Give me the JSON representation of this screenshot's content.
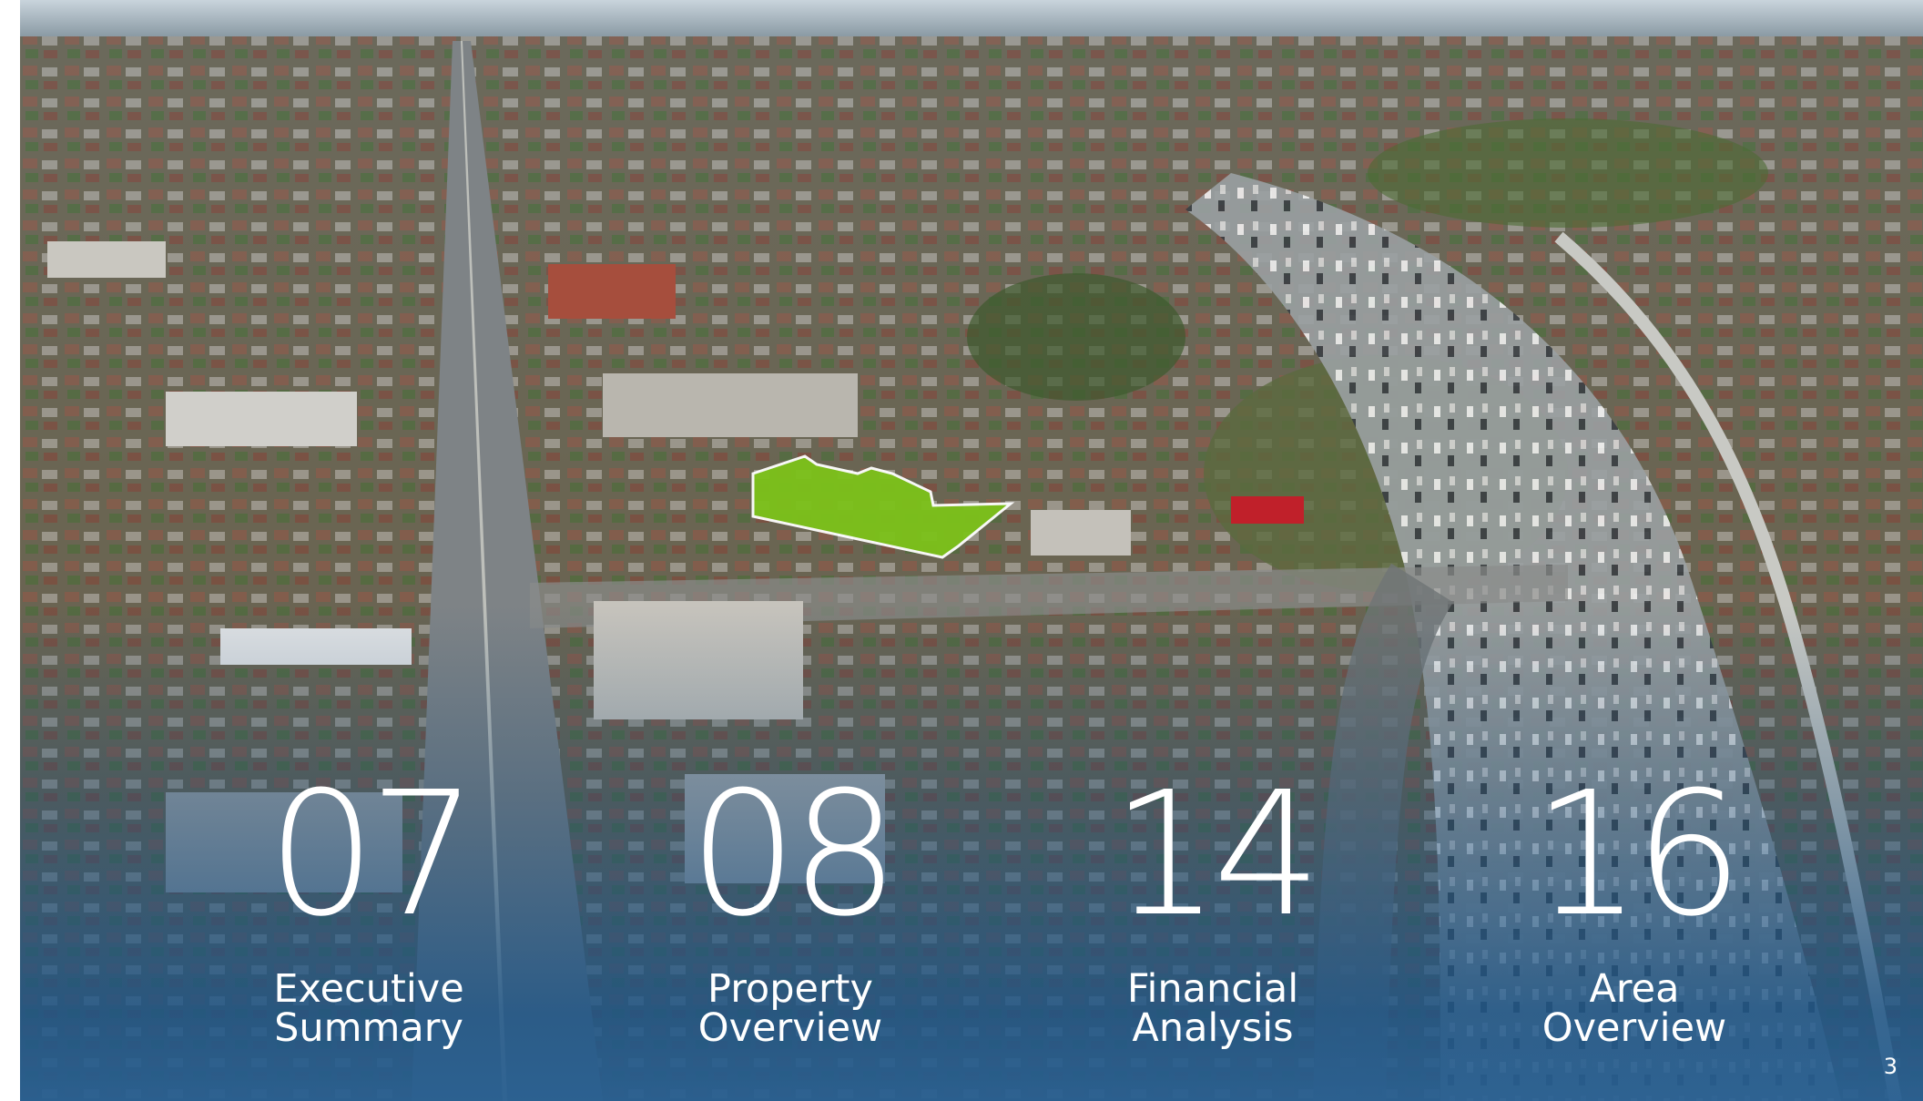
{
  "toc": [
    {
      "number": "07",
      "line1": "Executive",
      "line2": "Summary"
    },
    {
      "number": "08",
      "line1": "Property",
      "line2": "Overview"
    },
    {
      "number": "14",
      "line1": "Financial",
      "line2": "Analysis"
    },
    {
      "number": "16",
      "line1": "Area",
      "line2": "Overview"
    }
  ],
  "page_number": "3",
  "colors": {
    "text": "#ffffff",
    "highlight_parcel": "#7cc21a",
    "bottom_tint": "#2f6494"
  }
}
